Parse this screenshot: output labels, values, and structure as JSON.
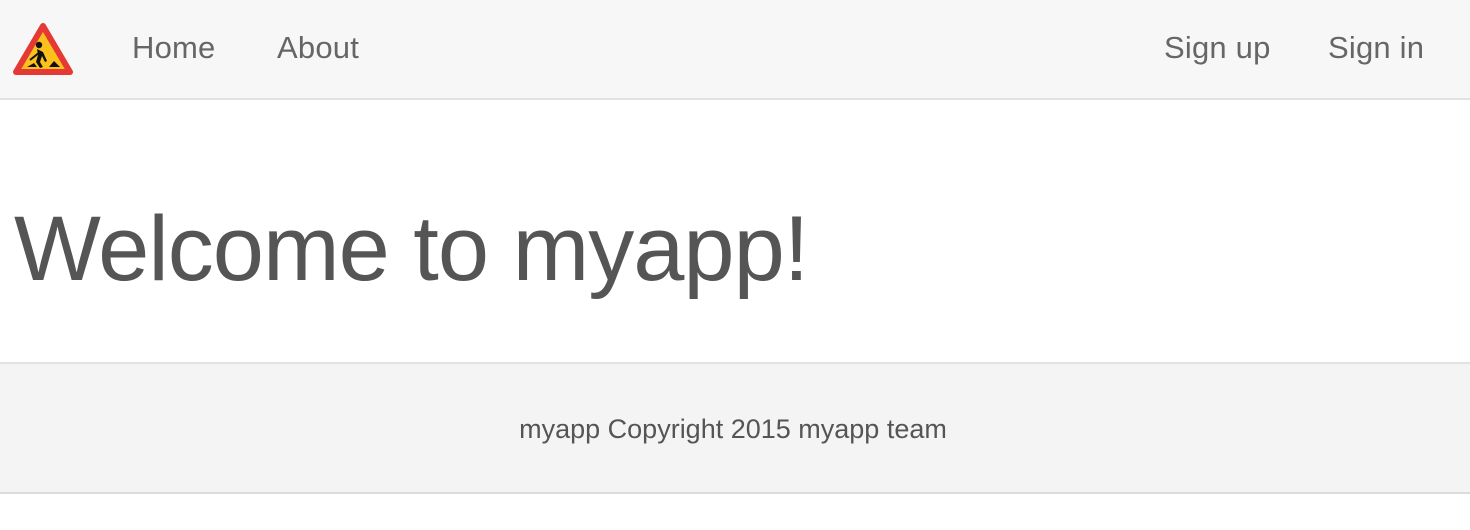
{
  "navbar": {
    "logo_icon": "road-work-warning-icon",
    "links_left": [
      "Home",
      "About"
    ],
    "links_right": [
      "Sign up",
      "Sign in"
    ]
  },
  "hero": {
    "title": "Welcome to myapp!"
  },
  "footer": {
    "text": "myapp Copyright 2015 myapp team"
  },
  "colors": {
    "navbar_bg": "#f7f7f7",
    "footer_bg": "#f4f4f4",
    "text": "#555555",
    "warning_red": "#e53935",
    "warning_yellow": "#fcc21b"
  }
}
